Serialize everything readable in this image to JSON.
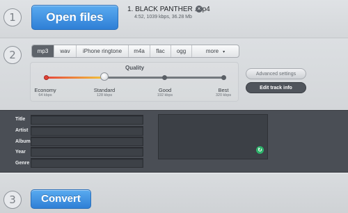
{
  "steps": {
    "one": "1",
    "two": "2",
    "three": "3"
  },
  "open_files": {
    "label": "Open files"
  },
  "file": {
    "name": "1. BLACK PANTHER .mp4",
    "meta": "4:52, 1039 kbps, 36.28 Mb",
    "remove_icon": "close-circle-icon",
    "remove_glyph": "×"
  },
  "format_tabs": [
    {
      "label": "mp3",
      "selected": true
    },
    {
      "label": "wav",
      "selected": false
    },
    {
      "label": "iPhone ringtone",
      "selected": false
    },
    {
      "label": "m4a",
      "selected": false
    },
    {
      "label": "flac",
      "selected": false
    },
    {
      "label": "ogg",
      "selected": false
    },
    {
      "label": "more",
      "selected": false
    }
  ],
  "more_arrow": "▾",
  "quality": {
    "title": "Quality",
    "selected_index": 1,
    "levels": [
      {
        "name": "Economy",
        "rate": "64 kbps"
      },
      {
        "name": "Standard",
        "rate": "128 kbps"
      },
      {
        "name": "Good",
        "rate": "192 kbps"
      },
      {
        "name": "Best",
        "rate": "320 kbps"
      }
    ]
  },
  "buttons": {
    "advanced_settings": "Advanced settings",
    "edit_track_info": "Edit track info"
  },
  "tags": {
    "labels": [
      "Title",
      "Artist",
      "Album",
      "Year",
      "Genre"
    ],
    "values": [
      "",
      "",
      "",
      "",
      ""
    ]
  },
  "cover_icon": {
    "name": "refresh-icon",
    "glyph": "↻"
  },
  "convert": {
    "label": "Convert"
  },
  "colors": {
    "accent_blue": "#3a8fe2",
    "slider_red": "#e6473c",
    "slider_yellow": "#f2c43a",
    "panel_dark": "#4a4e55",
    "refresh_green": "#2db36a"
  }
}
